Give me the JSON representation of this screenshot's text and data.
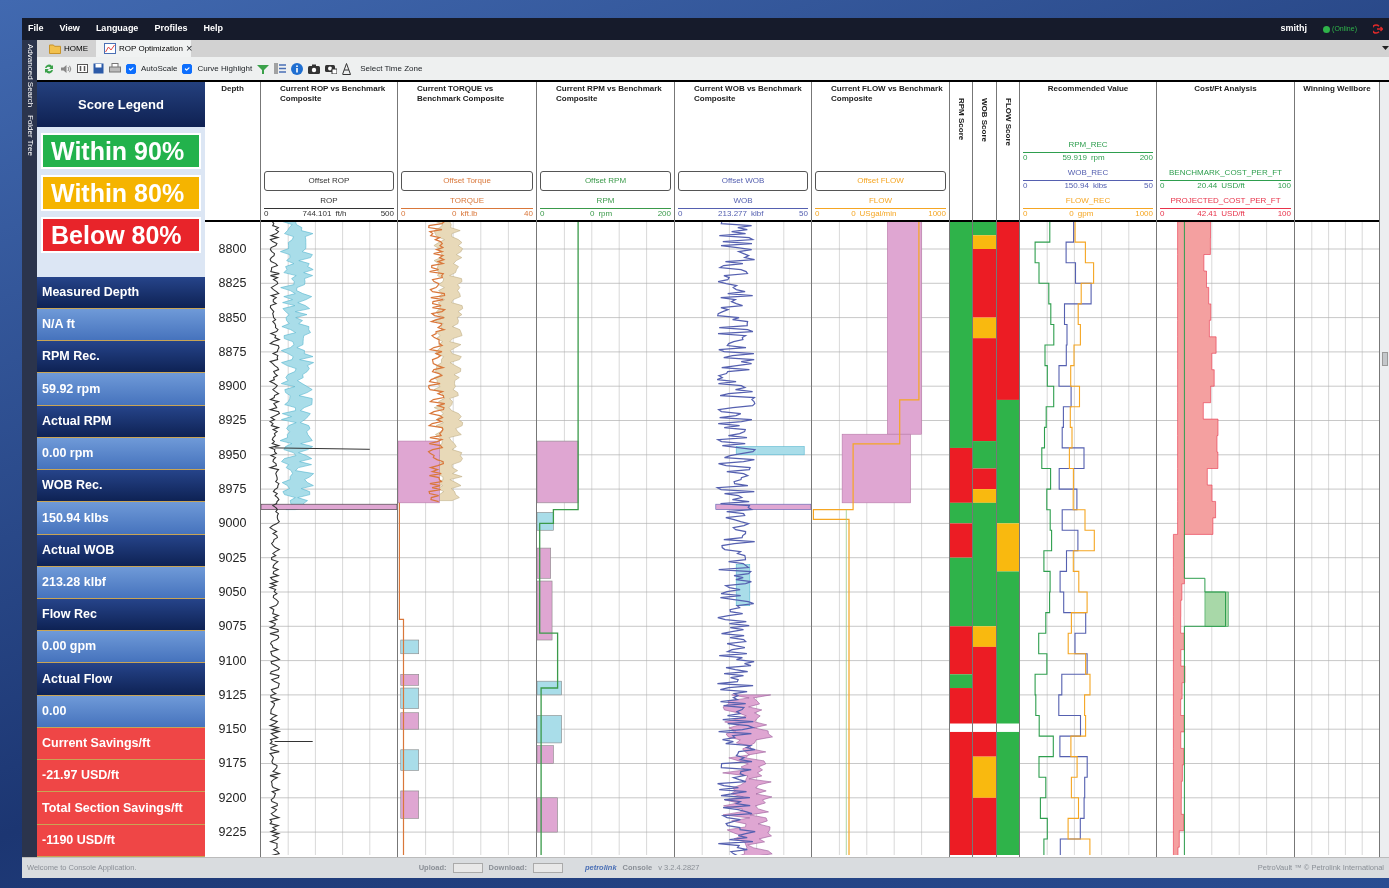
{
  "menu": [
    "File",
    "View",
    "Language",
    "Profiles",
    "Help"
  ],
  "user": {
    "name": "smithj",
    "status": "(Online)"
  },
  "side_tabs": [
    "Advanced Search",
    "Folder Tree"
  ],
  "tabs": [
    {
      "label": "HOME",
      "selected": false,
      "kind": "folder"
    },
    {
      "label": "ROP Optimization",
      "selected": true,
      "close": "×",
      "kind": "chart"
    }
  ],
  "toolbar": {
    "autoscale": {
      "label": "AutoScale",
      "checked": true
    },
    "curve_highlight": {
      "label": "Curve Highlight",
      "checked": true
    },
    "time_zone": "Select Time Zone"
  },
  "score_legend": {
    "title": "Score Legend",
    "items": [
      {
        "label": "Within 90%",
        "color": "#22b24c"
      },
      {
        "label": "Within 80%",
        "color": "#f5b400"
      },
      {
        "label": "Below 80%",
        "color": "#e8242a"
      }
    ]
  },
  "readouts": [
    {
      "label": "Measured Depth",
      "value": "N/A ft",
      "kind": "drilling"
    },
    {
      "label": "RPM Rec.",
      "value": "59.92 rpm",
      "kind": "drilling"
    },
    {
      "label": "Actual RPM",
      "value": "0.00 rpm",
      "kind": "drilling"
    },
    {
      "label": "WOB Rec.",
      "value": "150.94 klbs",
      "kind": "drilling"
    },
    {
      "label": "Actual WOB",
      "value": "213.28 klbf",
      "kind": "drilling"
    },
    {
      "label": "Flow Rec",
      "value": "0.00 gpm",
      "kind": "drilling"
    },
    {
      "label": "Actual Flow",
      "value": "0.00",
      "kind": "drilling"
    },
    {
      "label": "Current Savings/ft",
      "value": "-21.97 USD/ft",
      "kind": "savings"
    },
    {
      "label": "Total Section Savings/ft",
      "value": "-1190 USD/ft",
      "kind": "savings"
    }
  ],
  "log": {
    "depth_header": "Depth",
    "depth_labels": [
      "8800",
      "8825",
      "8850",
      "8875",
      "8900",
      "8925",
      "8950",
      "8975",
      "9000",
      "9025",
      "9050",
      "9075",
      "9100",
      "9125",
      "9150",
      "9175",
      "9200",
      "9225"
    ],
    "tracks": [
      {
        "title": "Current ROP vs Benchmark Composite",
        "offset_label": "Offset ROP",
        "curve": {
          "name": "ROP",
          "min": "0",
          "value": "744.101",
          "unit": "ft/h",
          "max": "500",
          "color": "#333333"
        }
      },
      {
        "title": "Current TORQUE vs Benchmark Composite",
        "offset_label": "Offset Torque",
        "curve": {
          "name": "TORQUE",
          "min": "0",
          "value": "0",
          "unit": "kft.lb",
          "max": "40",
          "color": "#d9773a"
        }
      },
      {
        "title": "Current RPM vs Benchmark Composite",
        "offset_label": "Offset RPM",
        "curve": {
          "name": "RPM",
          "min": "0",
          "value": "0",
          "unit": "rpm",
          "max": "200",
          "color": "#3a9a4a"
        }
      },
      {
        "title": "Current WOB vs Benchmark Composite",
        "offset_label": "Offset WOB",
        "curve": {
          "name": "WOB",
          "min": "0",
          "value": "213.277",
          "unit": "klbf",
          "max": "50",
          "color": "#5560b0"
        }
      },
      {
        "title": "Current FLOW vs Benchmark Composite",
        "offset_label": "Offset FLOW",
        "curve": {
          "name": "FLOW",
          "min": "0",
          "value": "0",
          "unit": "USgal/min",
          "max": "1000",
          "color": "#f5a623"
        }
      }
    ],
    "score_tracks": [
      "RPM Score",
      "WOB Score",
      "FLOW Score"
    ],
    "recommended": {
      "title": "Recommended Value",
      "curves": [
        {
          "name": "RPM_REC",
          "min": "0",
          "value": "59.919",
          "unit": "rpm",
          "max": "200",
          "color": "#2e9e4e"
        },
        {
          "name": "WOB_REC",
          "min": "0",
          "value": "150.94",
          "unit": "klbs",
          "max": "50",
          "color": "#5560b0"
        },
        {
          "name": "FLOW_REC",
          "min": "0",
          "value": "0",
          "unit": "gpm",
          "max": "1000",
          "color": "#f5a623"
        }
      ]
    },
    "cost": {
      "title": "Cost/Ft Analysis",
      "curves": [
        {
          "name": "BENCHMARK_COST_PER_FT",
          "min": "0",
          "value": "20.44",
          "unit": "USD/ft",
          "max": "100",
          "color": "#2e9e4e"
        },
        {
          "name": "PROJECTED_COST_PER_FT",
          "min": "0",
          "value": "42.41",
          "unit": "USD/ft",
          "max": "100",
          "color": "#e8334a"
        }
      ]
    },
    "winning": {
      "title": "Winning Wellbore"
    }
  },
  "status_bar": {
    "message": "Welcome to Console Application.",
    "upload": "Upload:",
    "upload_progress": {
      "level": 0
    },
    "download": "Download:",
    "download_progress": {
      "level": 0
    },
    "logo": "petrolink",
    "app": "Console",
    "version": "v 3.2.4.2827",
    "copyright": "PetroVault ™ © Petrolink International"
  }
}
